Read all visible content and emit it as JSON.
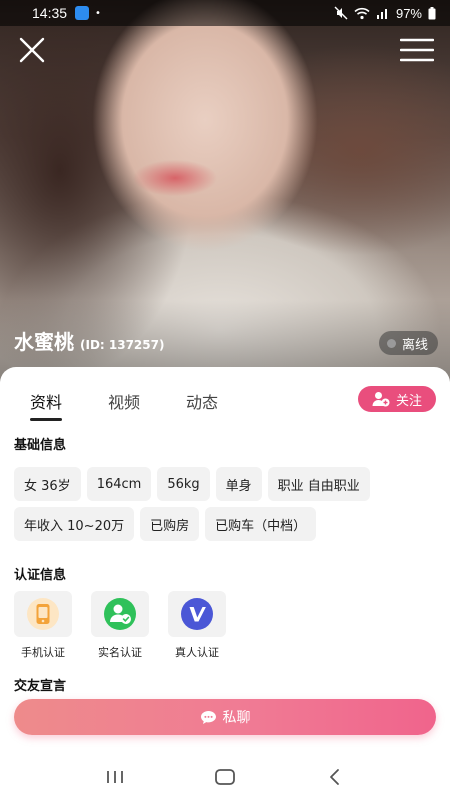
{
  "status_bar": {
    "time": "14:35",
    "extra": "•",
    "battery": "97%"
  },
  "profile": {
    "name": "水蜜桃",
    "id_text": "(ID: 137257)",
    "status": "离线"
  },
  "tabs": [
    {
      "label": "资料"
    },
    {
      "label": "视频"
    },
    {
      "label": "动态"
    }
  ],
  "follow_label": "关注",
  "basic_info": {
    "title": "基础信息",
    "chips": [
      "女 36岁",
      "164cm",
      "56kg",
      "单身",
      "职业 自由职业",
      "年收入 10~20万",
      "已购房",
      "已购车（中档）"
    ]
  },
  "certification": {
    "title": "认证信息",
    "items": [
      {
        "label": "手机认证",
        "icon": "phone-icon"
      },
      {
        "label": "实名认证",
        "icon": "verified-user-icon"
      },
      {
        "label": "真人认证",
        "icon": "v-badge-icon"
      }
    ]
  },
  "dating_declaration": {
    "title": "交友宣言"
  },
  "chat_button": {
    "label": "私聊"
  },
  "colors": {
    "accent": "#e94e7d",
    "tab_active": "#222222",
    "chip_bg": "#f2f2f2"
  }
}
